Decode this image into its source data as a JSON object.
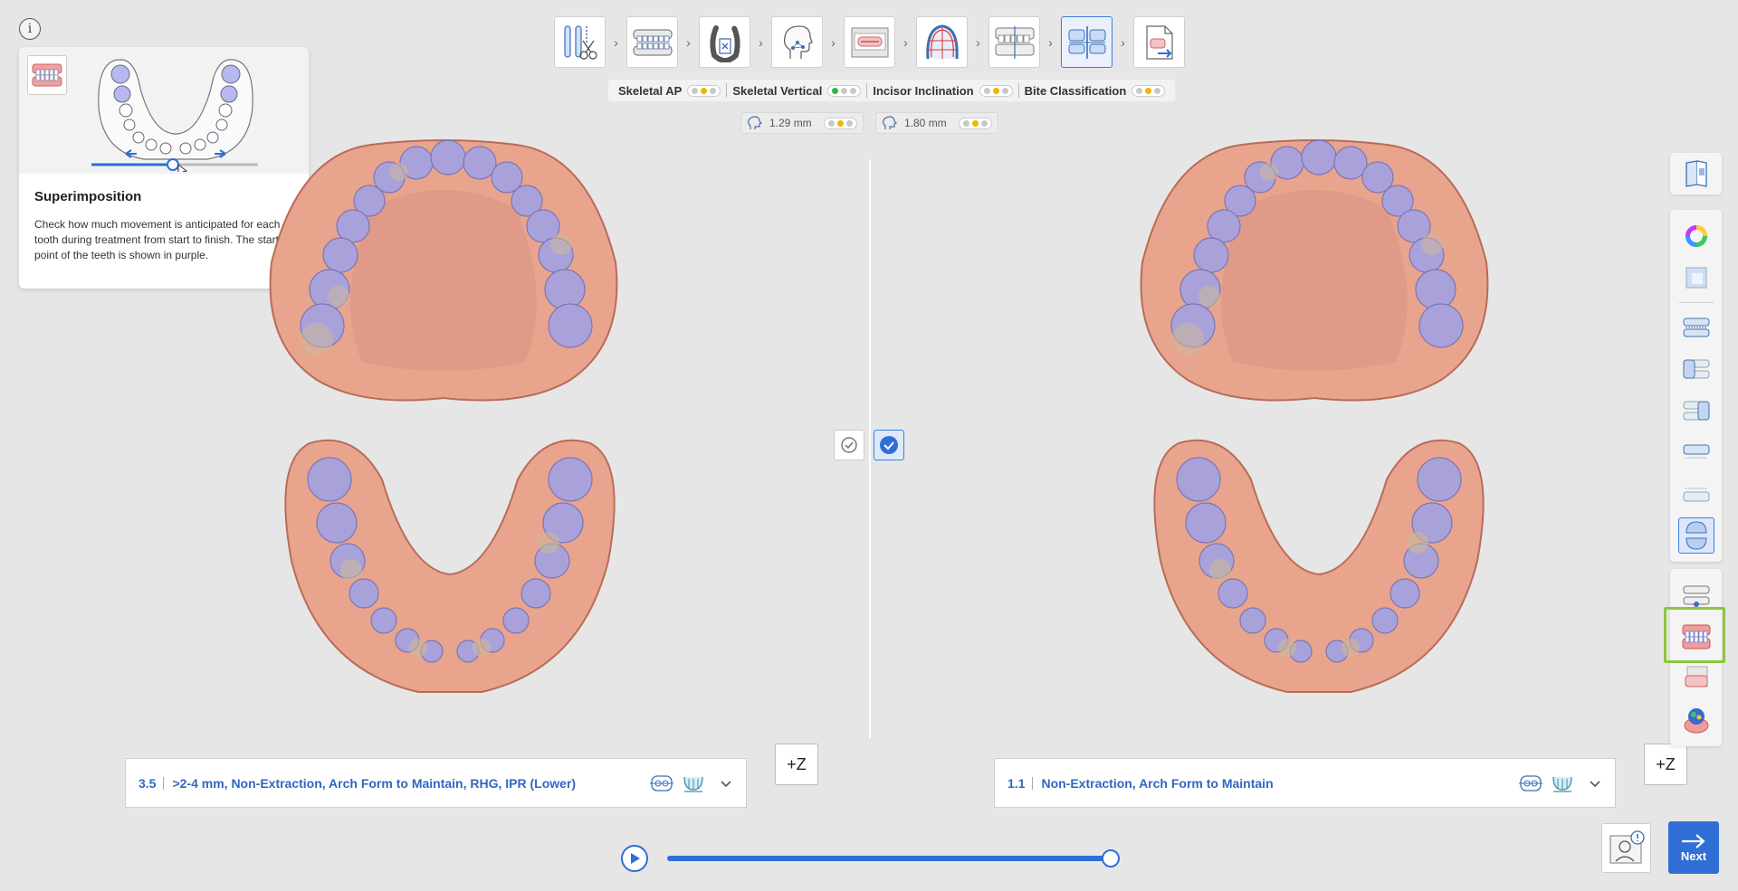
{
  "tooltip": {
    "title": "Superimposition",
    "description": "Check how much movement is anticipated for each tooth during treatment from start to finish. The starting point of the teeth is shown in purple."
  },
  "info_label": "i",
  "steps": [
    {
      "icon": "tools-icon"
    },
    {
      "icon": "dentition-icon"
    },
    {
      "icon": "tooth-segmentation-icon"
    },
    {
      "icon": "face-profile-icon"
    },
    {
      "icon": "xray-icon"
    },
    {
      "icon": "arch-form-icon"
    },
    {
      "icon": "occlusion-icon"
    },
    {
      "icon": "compare-plans-icon",
      "active": true
    },
    {
      "icon": "export-icon"
    }
  ],
  "analysis": [
    {
      "label": "Skeletal AP",
      "dots": [
        "grey",
        "yellow",
        "grey"
      ]
    },
    {
      "label": "Skeletal Vertical",
      "dots": [
        "green",
        "grey",
        "grey"
      ]
    },
    {
      "label": "Incisor Inclination",
      "dots": [
        "grey",
        "yellow",
        "grey"
      ]
    },
    {
      "label": "Bite Classification",
      "dots": [
        "grey",
        "yellow",
        "grey"
      ]
    }
  ],
  "measures": {
    "left": {
      "value": "1.29 mm",
      "dots": [
        "grey",
        "yellow",
        "grey"
      ]
    },
    "right": {
      "value": "1.80 mm",
      "dots": [
        "grey",
        "yellow",
        "grey"
      ]
    }
  },
  "plans": {
    "left": {
      "number": "3.5",
      "text": ">2-4 mm, Non-Extraction, Arch Form to Maintain, RHG, IPR (Lower)"
    },
    "right": {
      "number": "1.1",
      "text": "Non-Extraction, Arch Form to Maintain"
    }
  },
  "z_label": "+Z",
  "playback": {
    "progress": 1.0
  },
  "next_label": "Next",
  "colors": {
    "accent": "#2f6fd6",
    "highlight": "#8dc63f",
    "gum": "#e8a08a",
    "tooth_start": "#9b9be0",
    "tooth_end": "#c9b89a"
  }
}
